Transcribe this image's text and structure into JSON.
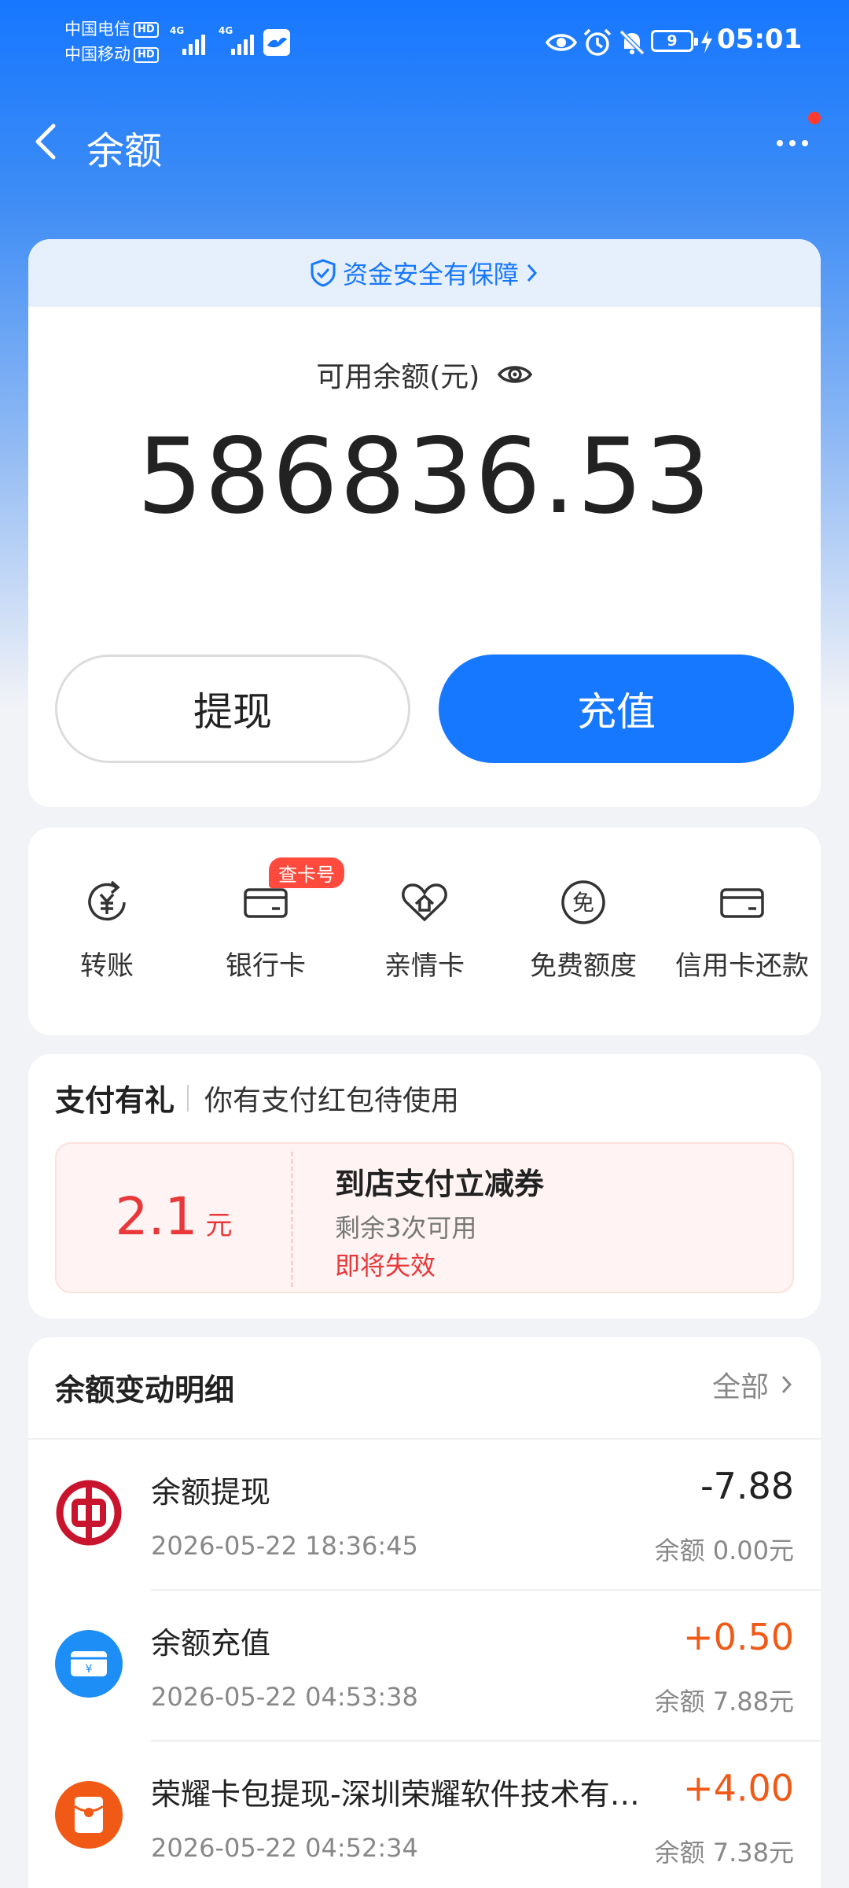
{
  "status_bar": {
    "carrier1": "中国电信",
    "carrier2": "中国移动",
    "hd": "HD",
    "net1": "4G",
    "net2": "4G",
    "battery": "9",
    "time": "05:01"
  },
  "header": {
    "title": "余额"
  },
  "security": {
    "text": "资金安全有保障"
  },
  "balance": {
    "label": "可用余额(元)",
    "amount": "586836.53"
  },
  "buttons": {
    "withdraw": "提现",
    "recharge": "充值"
  },
  "actions": [
    {
      "label": "转账",
      "icon": "transfer-icon"
    },
    {
      "label": "银行卡",
      "icon": "bank-card-icon"
    },
    {
      "label": "亲情卡",
      "icon": "family-card-icon"
    },
    {
      "label": "免费额度",
      "icon": "free-quota-icon"
    },
    {
      "label": "信用卡还款",
      "icon": "credit-card-icon"
    }
  ],
  "bank_tag": "查卡号",
  "promo": {
    "title": "支付有礼",
    "subtitle": "你有支付红包待使用",
    "coupon_amount": "2.1",
    "coupon_unit": "元",
    "coupon_name": "到店支付立减券",
    "coupon_left": "剩余3次可用",
    "coupon_expire": "即将失效"
  },
  "transactions": {
    "title": "余额变动明细",
    "all": "全部",
    "items": [
      {
        "title": "余额提现",
        "time": "2026-05-22 18:36:45",
        "amount": "-7.88",
        "balance": "余额 0.00元"
      },
      {
        "title": "余额充值",
        "time": "2026-05-22 04:53:38",
        "amount": "+0.50",
        "balance": "余额 7.88元"
      },
      {
        "title": "荣耀卡包提现-深圳荣耀软件技术有…",
        "time": "2026-05-22 04:52:34",
        "amount": "+4.00",
        "balance": "余额 7.38元"
      }
    ]
  },
  "colors": {
    "brand_blue": "#1677ff",
    "red": "#e8383a",
    "orange": "#f05a16"
  }
}
